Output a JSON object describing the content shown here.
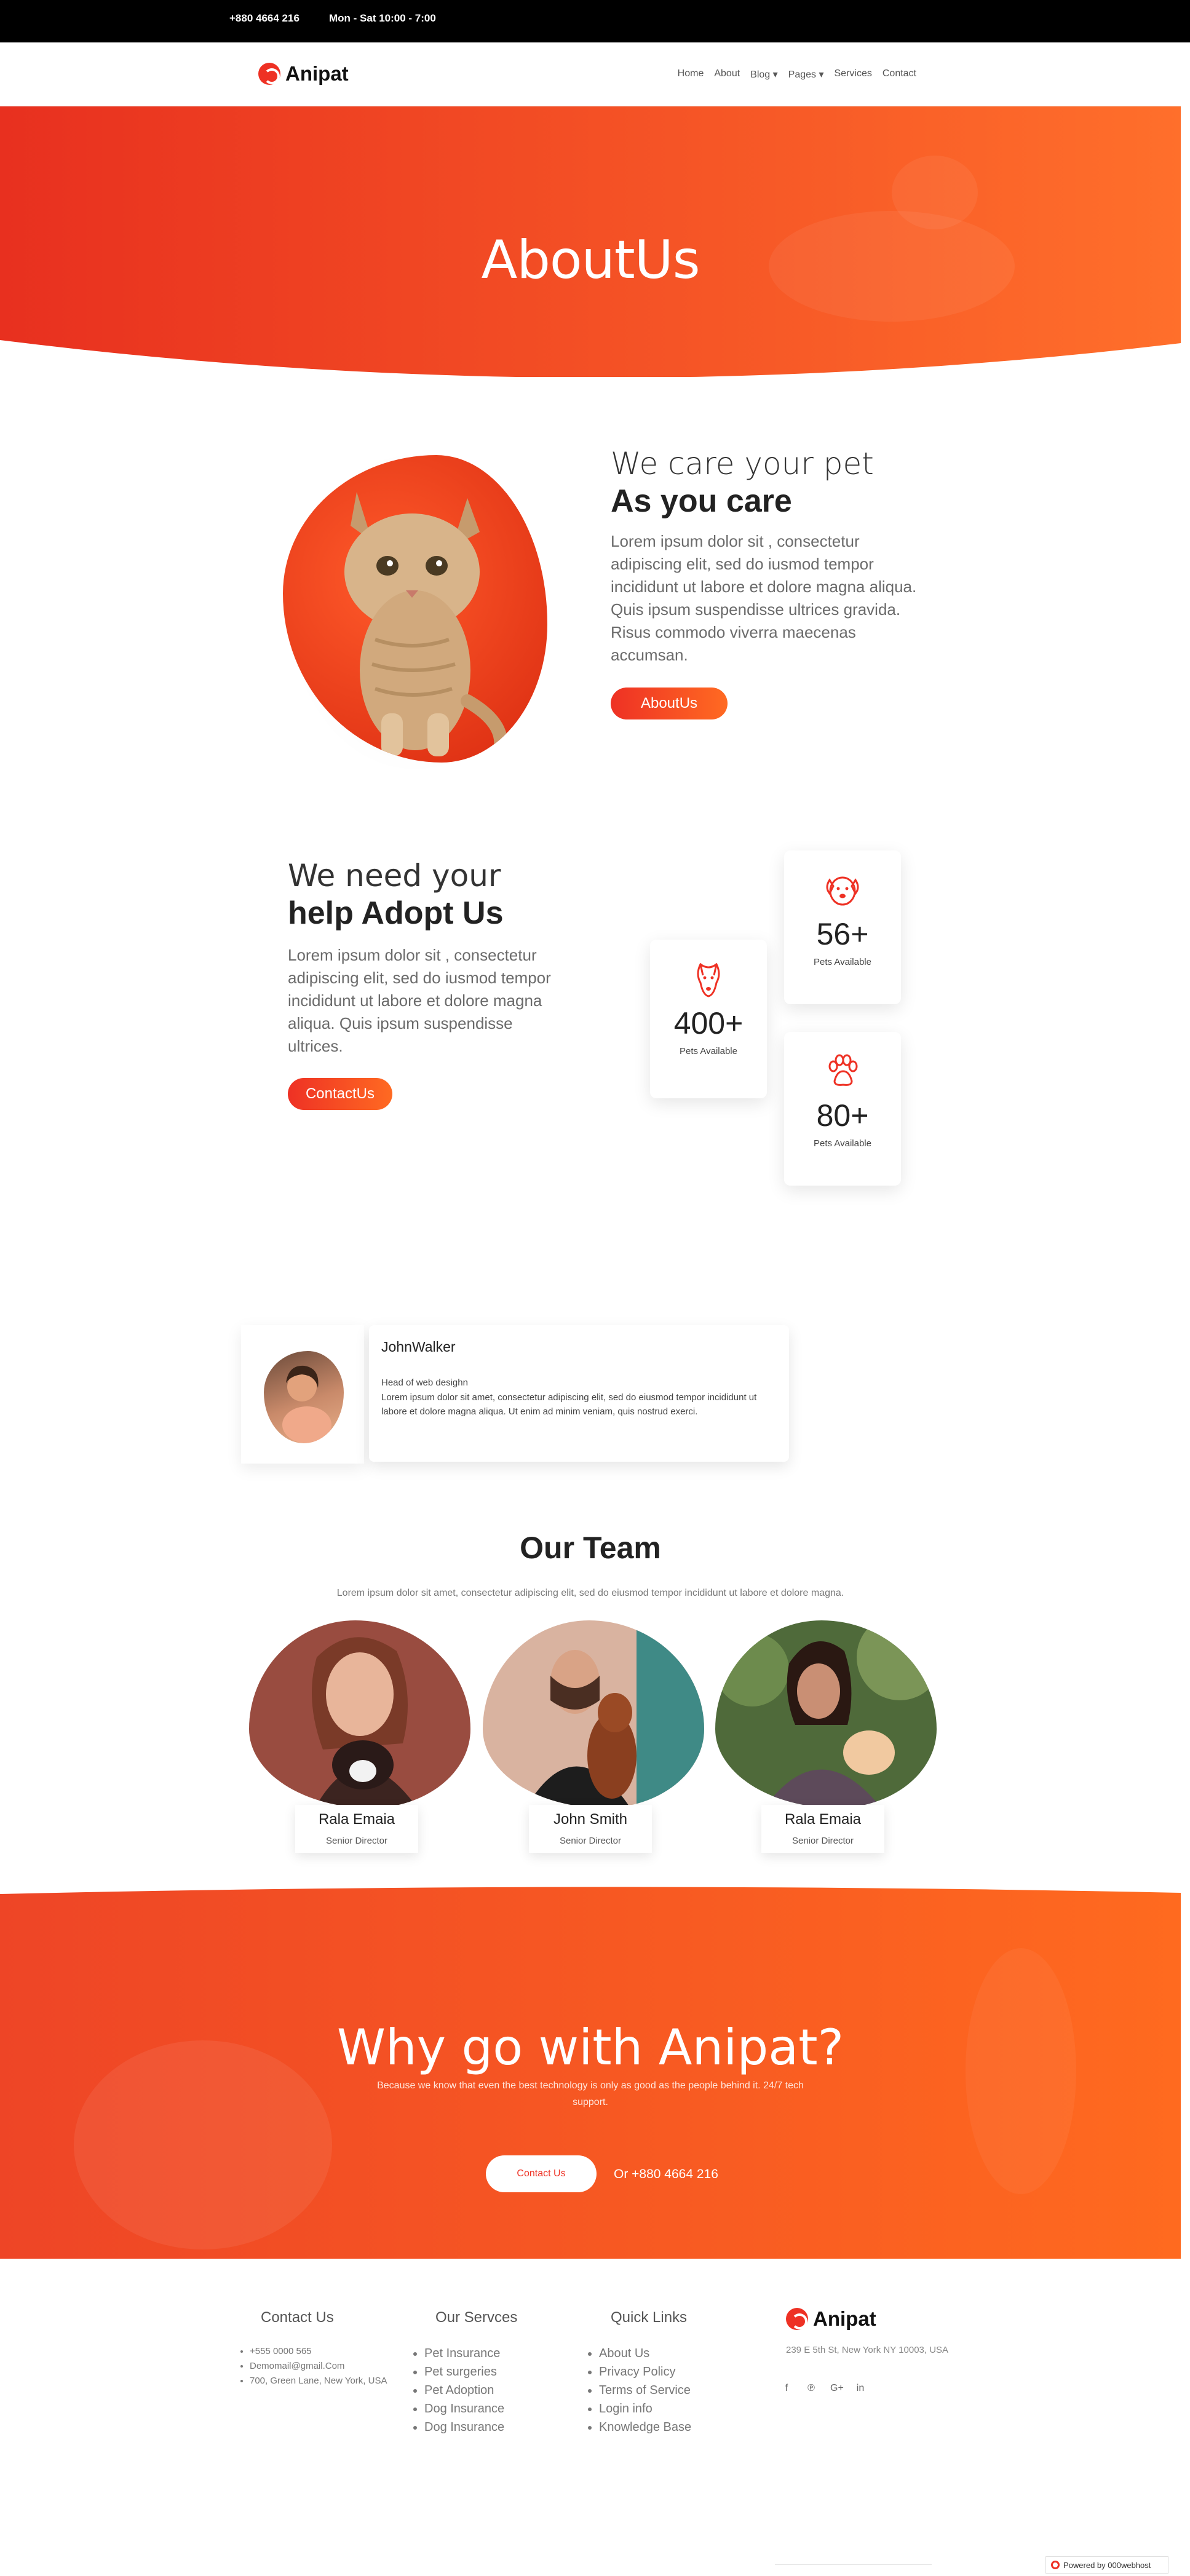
{
  "topbar": {
    "phone": "+880 4664 216",
    "hours": "Mon - Sat 10:00 - 7:00"
  },
  "nav": {
    "logo": "Anipat",
    "items": [
      "Home",
      "About",
      "Blog ▾",
      "Pages ▾",
      "Services",
      "Contact"
    ]
  },
  "hero": {
    "title": "AboutUs"
  },
  "about": {
    "line1": "We care your pet",
    "line2": "As you care",
    "text": "Lorem ipsum dolor sit , consectetur adipiscing elit, sed do iusmod tempor incididunt ut labore et dolore magna aliqua. Quis ipsum suspendisse ultrices gravida. Risus commodo viverra maecenas accumsan.",
    "button": "AboutUs"
  },
  "adopt": {
    "line1": "We need your",
    "line2": "help Adopt Us",
    "text": "Lorem ipsum dolor sit , consectetur adipiscing elit, sed do iusmod tempor incididunt ut labore et dolore magna aliqua. Quis ipsum suspendisse ultrices.",
    "button": "ContactUs"
  },
  "stats": [
    {
      "icon": "dog-face-icon",
      "value": "56+",
      "label": "Pets Available"
    },
    {
      "icon": "dog-head-icon",
      "value": "400+",
      "label": "Pets Available"
    },
    {
      "icon": "paw-icon",
      "value": "80+",
      "label": "Pets Available"
    }
  ],
  "testimonial": {
    "name": "JohnWalker",
    "role": "Head of web desighn",
    "text": "Lorem ipsum dolor sit amet, consectetur adipiscing elit, sed do eiusmod tempor incididunt ut labore et dolore magna aliqua. Ut enim ad minim veniam, quis nostrud exerci."
  },
  "team": {
    "title": "Our Team",
    "subtitle": "Lorem ipsum dolor sit amet, consectetur adipiscing elit, sed do eiusmod tempor incididunt ut labore et dolore magna.",
    "members": [
      {
        "name": "Rala Emaia",
        "role": "Senior Director"
      },
      {
        "name": "John Smith",
        "role": "Senior Director"
      },
      {
        "name": "Rala Emaia",
        "role": "Senior Director"
      }
    ]
  },
  "cta": {
    "title": "Why go with Anipat?",
    "text": "Because we know that even the best technology is only as good as the people behind it. 24/7 tech support.",
    "button": "Contact Us",
    "or_phone": "Or +880 4664 216"
  },
  "footer": {
    "contact": {
      "heading": "Contact Us",
      "items": [
        "+555 0000 565",
        "Demomail@gmail.Com",
        "700, Green Lane, New York, USA"
      ]
    },
    "services": {
      "heading": "Our Servces",
      "items": [
        "Pet Insurance",
        "Pet surgeries",
        "Pet Adoption",
        "Dog Insurance",
        "Dog Insurance"
      ]
    },
    "links": {
      "heading": "Quick Links",
      "items": [
        "About Us",
        "Privacy Policy",
        "Terms of Service",
        "Login info",
        "Knowledge Base"
      ]
    },
    "brand": "Anipat",
    "address": "239 E 5th St, New York NY 10003, USA",
    "social": [
      "f",
      "℗",
      "G+",
      "in"
    ],
    "badge": "Powered by  000webhost"
  },
  "colors": {
    "accent": "#ee3124",
    "accent2": "#ff6a22"
  }
}
